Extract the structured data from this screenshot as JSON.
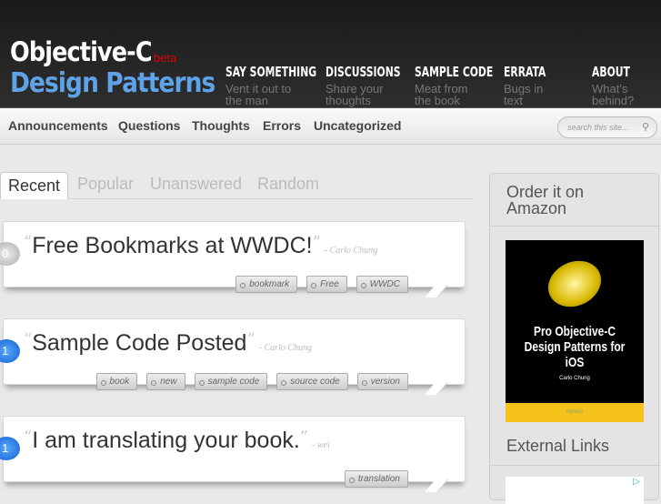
{
  "logo": {
    "line1": "Objective-C",
    "beta": "beta",
    "line2": "Design Patterns"
  },
  "nav": [
    {
      "title": "SAY SOMETHING",
      "sub": "Vent it out to the man"
    },
    {
      "title": "DISCUSSIONS",
      "sub": "Share your thoughts"
    },
    {
      "title": "SAMPLE CODE",
      "sub": "Meat from the book"
    },
    {
      "title": "ERRATA",
      "sub": "Bugs in text"
    },
    {
      "title": "ABOUT",
      "sub": "What's behind?"
    }
  ],
  "categories": [
    "Announcements",
    "Questions",
    "Thoughts",
    "Errors",
    "Uncategorized"
  ],
  "search": {
    "placeholder": "search this site...",
    "icon": "search-icon"
  },
  "tabs": [
    "Recent",
    "Popular",
    "Unanswered",
    "Random"
  ],
  "posts": [
    {
      "count": "0",
      "title": "Free Bookmarks at WWDC!",
      "author": "- Carlo Chung",
      "tags": [
        "bookmark",
        "Free",
        "WWDC"
      ]
    },
    {
      "count": "1",
      "title": "Sample Code Posted",
      "author": "- Carlo Chung",
      "tags": [
        "book",
        "new",
        "sample code",
        "source code",
        "version"
      ]
    },
    {
      "count": "1",
      "title": "I am translating your book.",
      "author": "- wei",
      "tags": [
        "translation"
      ]
    }
  ],
  "sidebar": {
    "order_heading": "Order it on Amazon",
    "book": {
      "title": "Pro Objective-C Design Patterns for iOS",
      "author": "Carlo Chung",
      "publisher": "Apress"
    },
    "links_heading": "External Links"
  },
  "colors": {
    "header": "#222222",
    "logo_blue": "#5ea2e8",
    "beta_red": "#dd0000"
  }
}
